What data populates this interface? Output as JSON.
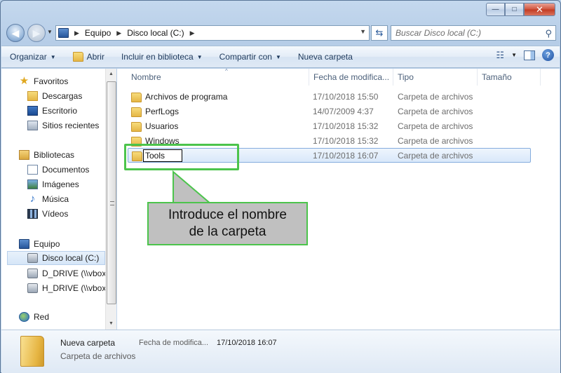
{
  "window": {
    "minimize_glyph": "—",
    "maximize_glyph": "□",
    "close_glyph": "✕"
  },
  "address": {
    "crumbs": [
      "Equipo",
      "Disco local (C:)"
    ],
    "search_placeholder": "Buscar Disco local (C:)"
  },
  "toolbar": {
    "organize": "Organizar",
    "open": "Abrir",
    "include_library": "Incluir en biblioteca",
    "share_with": "Compartir con",
    "new_folder": "Nueva carpeta"
  },
  "sidebar": {
    "favorites": {
      "label": "Favoritos",
      "items": [
        "Descargas",
        "Escritorio",
        "Sitios recientes"
      ]
    },
    "libraries": {
      "label": "Bibliotecas",
      "items": [
        "Documentos",
        "Imágenes",
        "Música",
        "Vídeos"
      ]
    },
    "computer": {
      "label": "Equipo",
      "items": [
        "Disco local (C:)",
        "D_DRIVE (\\\\vboxs",
        "H_DRIVE (\\\\vboxs"
      ]
    },
    "network": {
      "label": "Red"
    }
  },
  "columns": {
    "name": "Nombre",
    "date": "Fecha de modifica...",
    "type": "Tipo",
    "size": "Tamaño"
  },
  "files": [
    {
      "name": "Archivos de programa",
      "date": "17/10/2018 15:50",
      "type": "Carpeta de archivos"
    },
    {
      "name": "PerfLogs",
      "date": "14/07/2009 4:37",
      "type": "Carpeta de archivos"
    },
    {
      "name": "Usuarios",
      "date": "17/10/2018 15:32",
      "type": "Carpeta de archivos"
    },
    {
      "name": "Windows",
      "date": "17/10/2018 15:32",
      "type": "Carpeta de archivos"
    }
  ],
  "new_item": {
    "rename_value": "Tools",
    "date": "17/10/2018 16:07",
    "type": "Carpeta de archivos"
  },
  "callout": {
    "line1": "Introduce el nombre",
    "line2": "de la carpeta"
  },
  "details": {
    "name": "Nueva carpeta",
    "type": "Carpeta de archivos",
    "date_label": "Fecha de modifica...",
    "date_value": "17/10/2018 16:07"
  },
  "colors": {
    "highlight_green": "#4cc44c",
    "callout_gray": "#c0c0c0",
    "selection_blue": "#84acdd"
  }
}
